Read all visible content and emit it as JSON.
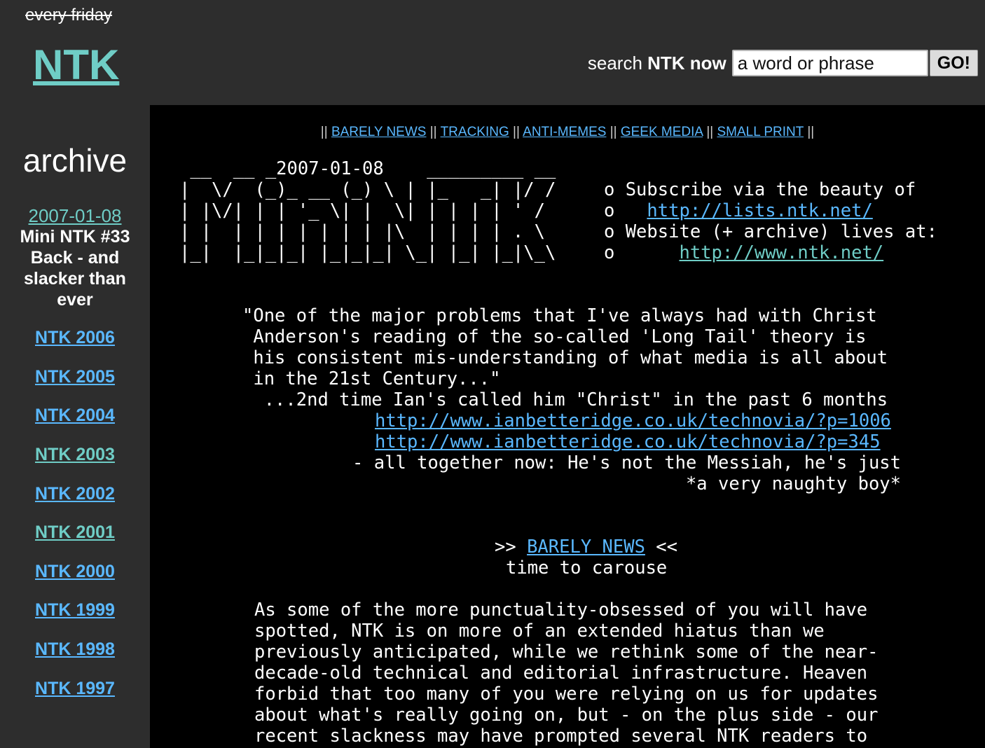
{
  "header": {
    "tagline": "every friday",
    "logo": "NTK",
    "search": {
      "label_prefix": "search ",
      "label_bold": "NTK now",
      "placeholder": "a word or phrase",
      "button": "GO!"
    }
  },
  "sidebar": {
    "heading": "archive",
    "current_issue": {
      "date": "2007-01-08",
      "title": "Mini NTK #33 Back - and slacker than ever"
    },
    "years": [
      {
        "label": "NTK 2006"
      },
      {
        "label": "NTK 2005"
      },
      {
        "label": "NTK 2004"
      },
      {
        "label": "NTK 2003"
      },
      {
        "label": "NTK 2002"
      },
      {
        "label": "NTK 2001"
      },
      {
        "label": "NTK 2000"
      },
      {
        "label": "NTK 1999"
      },
      {
        "label": "NTK 1998"
      },
      {
        "label": "NTK 1997"
      }
    ]
  },
  "nav": {
    "sep": "||",
    "items": [
      "BARELY NEWS",
      "TRACKING",
      "ANTI-MEMES",
      "GEEK MEDIA",
      "SMALL PRINT"
    ]
  },
  "banner": {
    "ascii": [
      " __  __ _2007-01-08    _________ __",
      "|  \\/  (_)_ __ (_) \\ | |_   _| |/ /",
      "| |\\/| | | '_ \\| |  \\| | | | | ' / ",
      "| |  | | | | | | | |\\  | | | | . \\ ",
      "|_|  |_|_|_| |_|_|_| \\_| |_| |_|\\_\\"
    ],
    "subscribe_lines": [
      {
        "prefix": "o Subscribe via the beauty of"
      },
      {
        "prefix": "o   ",
        "link": "http://lists.ntk.net/"
      },
      {
        "prefix": "o Website (+ archive) lives at:"
      },
      {
        "prefix": "o      ",
        "link": "http://www.ntk.net/"
      }
    ]
  },
  "quote": {
    "lines": [
      "\"One of the major problems that I've always had with Christ",
      " Anderson's reading of the so-called 'Long Tail' theory is",
      " his consistent mis-understanding of what media is all about",
      " in the 21st Century...\"",
      "  ...2nd time Ian's called him \"Christ\" in the past 6 months"
    ],
    "link1": "http://www.ianbetteridge.co.uk/technovia/?p=1006",
    "link2": "http://www.ianbetteridge.co.uk/technovia/?p=345",
    "tail_lines": [
      "- all together now: He's not the Messiah, he's just",
      "*a very naughty boy*"
    ]
  },
  "section": {
    "prefix": ">> ",
    "title": "BARELY NEWS",
    "suffix": " <<",
    "subtitle": "time to carouse"
  },
  "body_text": [
    "As some of the more punctuality-obsessed of you will have",
    "spotted, NTK is on more of an extended hiatus than we",
    "previously anticipated, while we rethink some of the near-",
    "decade-old technical and editorial infrastructure. Heaven",
    "forbid that too many of you were relying on us for updates",
    "about what's really going on, but - on the plus side - our",
    "recent slackness may have prompted several NTK readers to"
  ]
}
